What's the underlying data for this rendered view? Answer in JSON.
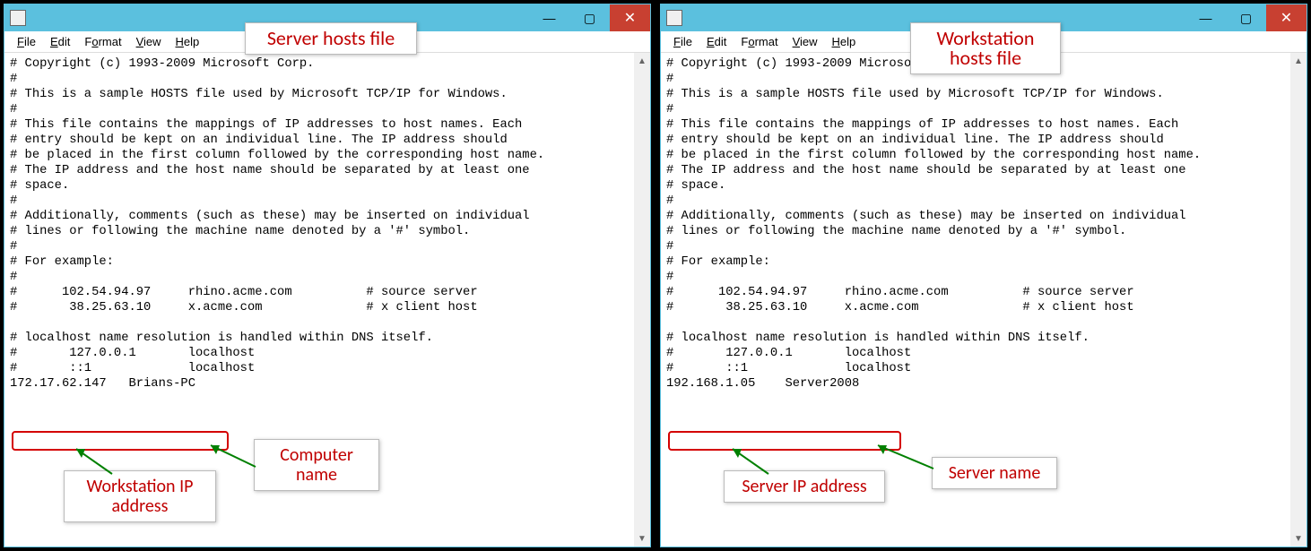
{
  "menus": [
    "File",
    "Edit",
    "Format",
    "View",
    "Help"
  ],
  "hosts_text_common": "# Copyright (c) 1993-2009 Microsoft Corp.\n#\n# This is a sample HOSTS file used by Microsoft TCP/IP for Windows.\n#\n# This file contains the mappings of IP addresses to host names. Each\n# entry should be kept on an individual line. The IP address should\n# be placed in the first column followed by the corresponding host name.\n# The IP address and the host name should be separated by at least one\n# space.\n#\n# Additionally, comments (such as these) may be inserted on individual\n# lines or following the machine name denoted by a '#' symbol.\n#\n# For example:\n#\n#      102.54.94.97     rhino.acme.com          # source server\n#       38.25.63.10     x.acme.com              # x client host\n\n# localhost name resolution is handled within DNS itself.\n#       127.0.0.1       localhost\n#       ::1             localhost",
  "left": {
    "heading": "Server hosts file",
    "entry_line": "172.17.62.147   Brians-PC",
    "label_a": "Computer name",
    "label_b": "Workstation IP\naddress"
  },
  "right": {
    "heading": "Workstation\nhosts file",
    "entry_line": "192.168.1.05    Server2008",
    "label_a": "Server name",
    "label_b": "Server IP address"
  }
}
